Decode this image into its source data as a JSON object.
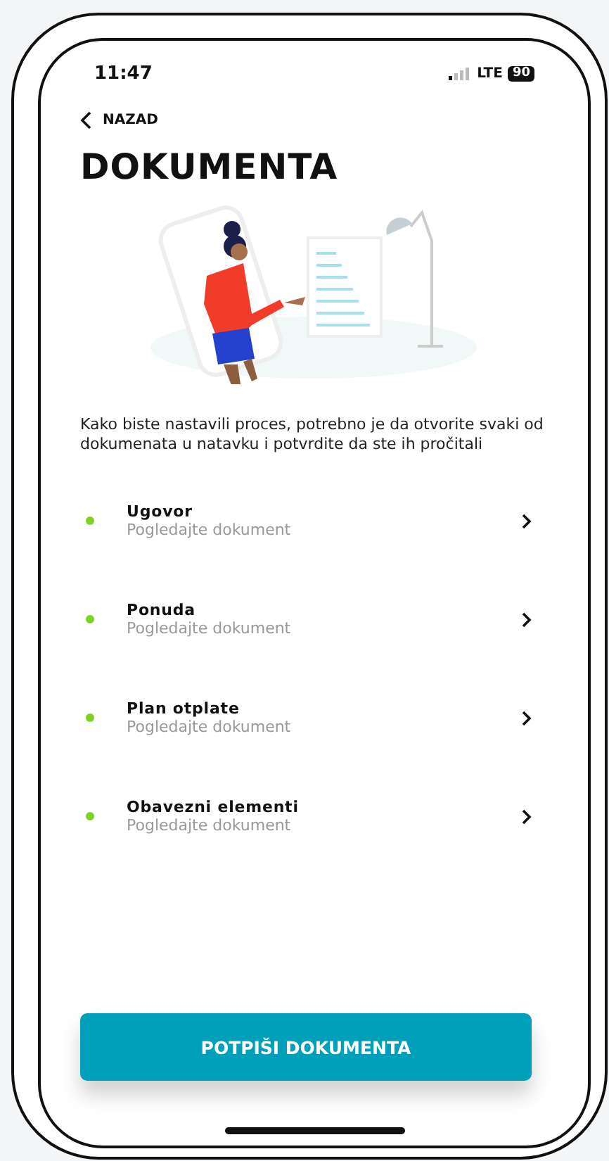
{
  "status_bar": {
    "time": "11:47",
    "network": "LTE",
    "battery": "90"
  },
  "back": {
    "label": "NAZAD"
  },
  "title": "DOKUMENTA",
  "intro": "Kako biste nastavili proces, potrebno je da otvorite svaki od dokumenata u natavku i potvrdite da ste ih pročitali",
  "documents": [
    {
      "name": "Ugovor",
      "subtitle": "Pogledajte dokument",
      "color": "#7ed321"
    },
    {
      "name": "Ponuda",
      "subtitle": "Pogledajte dokument",
      "color": "#7ed321"
    },
    {
      "name": "Plan otplate",
      "subtitle": "Pogledajte dokument",
      "color": "#7ed321"
    },
    {
      "name": "Obavezni elementi",
      "subtitle": "Pogledajte dokument",
      "color": "#7ed321"
    }
  ],
  "primary_button": {
    "label": "POTPIŠI DOKUMENTA"
  }
}
